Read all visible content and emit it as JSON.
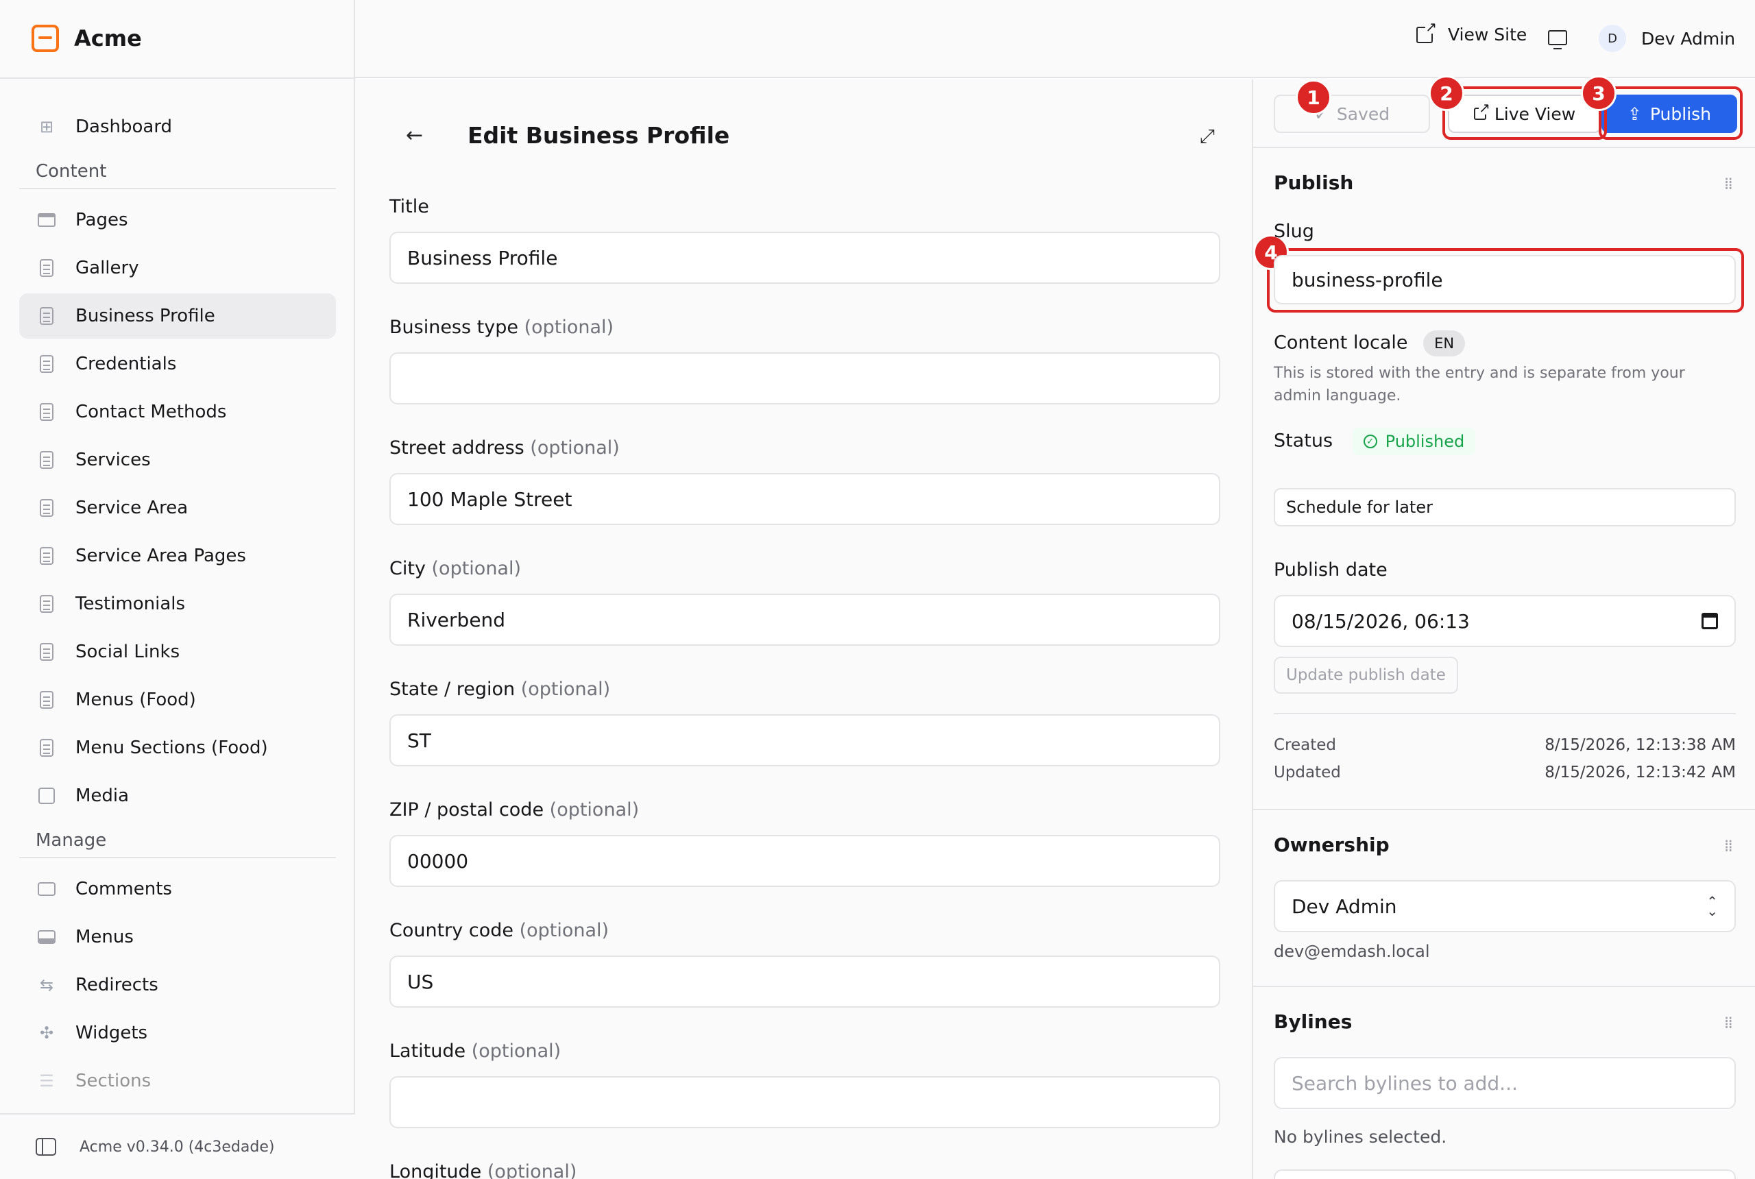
{
  "app": {
    "name": "Acme",
    "version": "Acme v0.34.0 (4c3edade)"
  },
  "topbar": {
    "view_site": "View Site",
    "user_initial": "D",
    "user_name": "Dev Admin"
  },
  "sidebar": {
    "dashboard": "Dashboard",
    "content_heading": "Content",
    "content_items": [
      "Pages",
      "Gallery",
      "Business Profile",
      "Credentials",
      "Contact Methods",
      "Services",
      "Service Area",
      "Service Area Pages",
      "Testimonials",
      "Social Links",
      "Menus (Food)",
      "Menu Sections (Food)",
      "Media"
    ],
    "active_item": "Business Profile",
    "manage_heading": "Manage",
    "manage_items": [
      "Comments",
      "Menus",
      "Redirects",
      "Widgets",
      "Sections"
    ]
  },
  "editor": {
    "title": "Edit Business Profile",
    "optional_suffix": "(optional)",
    "fields": [
      {
        "label": "Title",
        "optional": false,
        "value": "Business Profile"
      },
      {
        "label": "Business type",
        "optional": true,
        "value": ""
      },
      {
        "label": "Street address",
        "optional": true,
        "value": "100 Maple Street"
      },
      {
        "label": "City",
        "optional": true,
        "value": "Riverbend"
      },
      {
        "label": "State / region",
        "optional": true,
        "value": "ST"
      },
      {
        "label": "ZIP / postal code",
        "optional": true,
        "value": "00000"
      },
      {
        "label": "Country code",
        "optional": true,
        "value": "US"
      },
      {
        "label": "Latitude",
        "optional": true,
        "value": ""
      },
      {
        "label": "Longitude",
        "optional": true,
        "value": ""
      }
    ]
  },
  "actions": {
    "saved": "Saved",
    "live_view": "Live View",
    "publish": "Publish"
  },
  "markers": [
    "1",
    "2",
    "3",
    "4"
  ],
  "highlight_color": "#dc2626",
  "publish_panel": {
    "title": "Publish",
    "slug_label": "Slug",
    "slug_value": "business-profile",
    "locale_label": "Content locale",
    "locale_value": "EN",
    "locale_help": "This is stored with the entry and is separate from your admin language.",
    "status_label": "Status",
    "status_value": "Published",
    "schedule_button": "Schedule for later",
    "publish_date_label": "Publish date",
    "publish_date_value": "08/15/2026, 06:13",
    "update_date_button": "Update publish date",
    "created_label": "Created",
    "created_value": "8/15/2026, 12:13:38 AM",
    "updated_label": "Updated",
    "updated_value": "8/15/2026, 12:13:42 AM"
  },
  "ownership_panel": {
    "title": "Ownership",
    "owner": "Dev Admin",
    "email": "dev@emdash.local"
  },
  "bylines_panel": {
    "title": "Bylines",
    "search_placeholder": "Search bylines to add...",
    "empty_text": "No bylines selected."
  },
  "colors": {
    "primary": "#2563eb",
    "brand": "#f97316",
    "success": "#16a34a"
  }
}
